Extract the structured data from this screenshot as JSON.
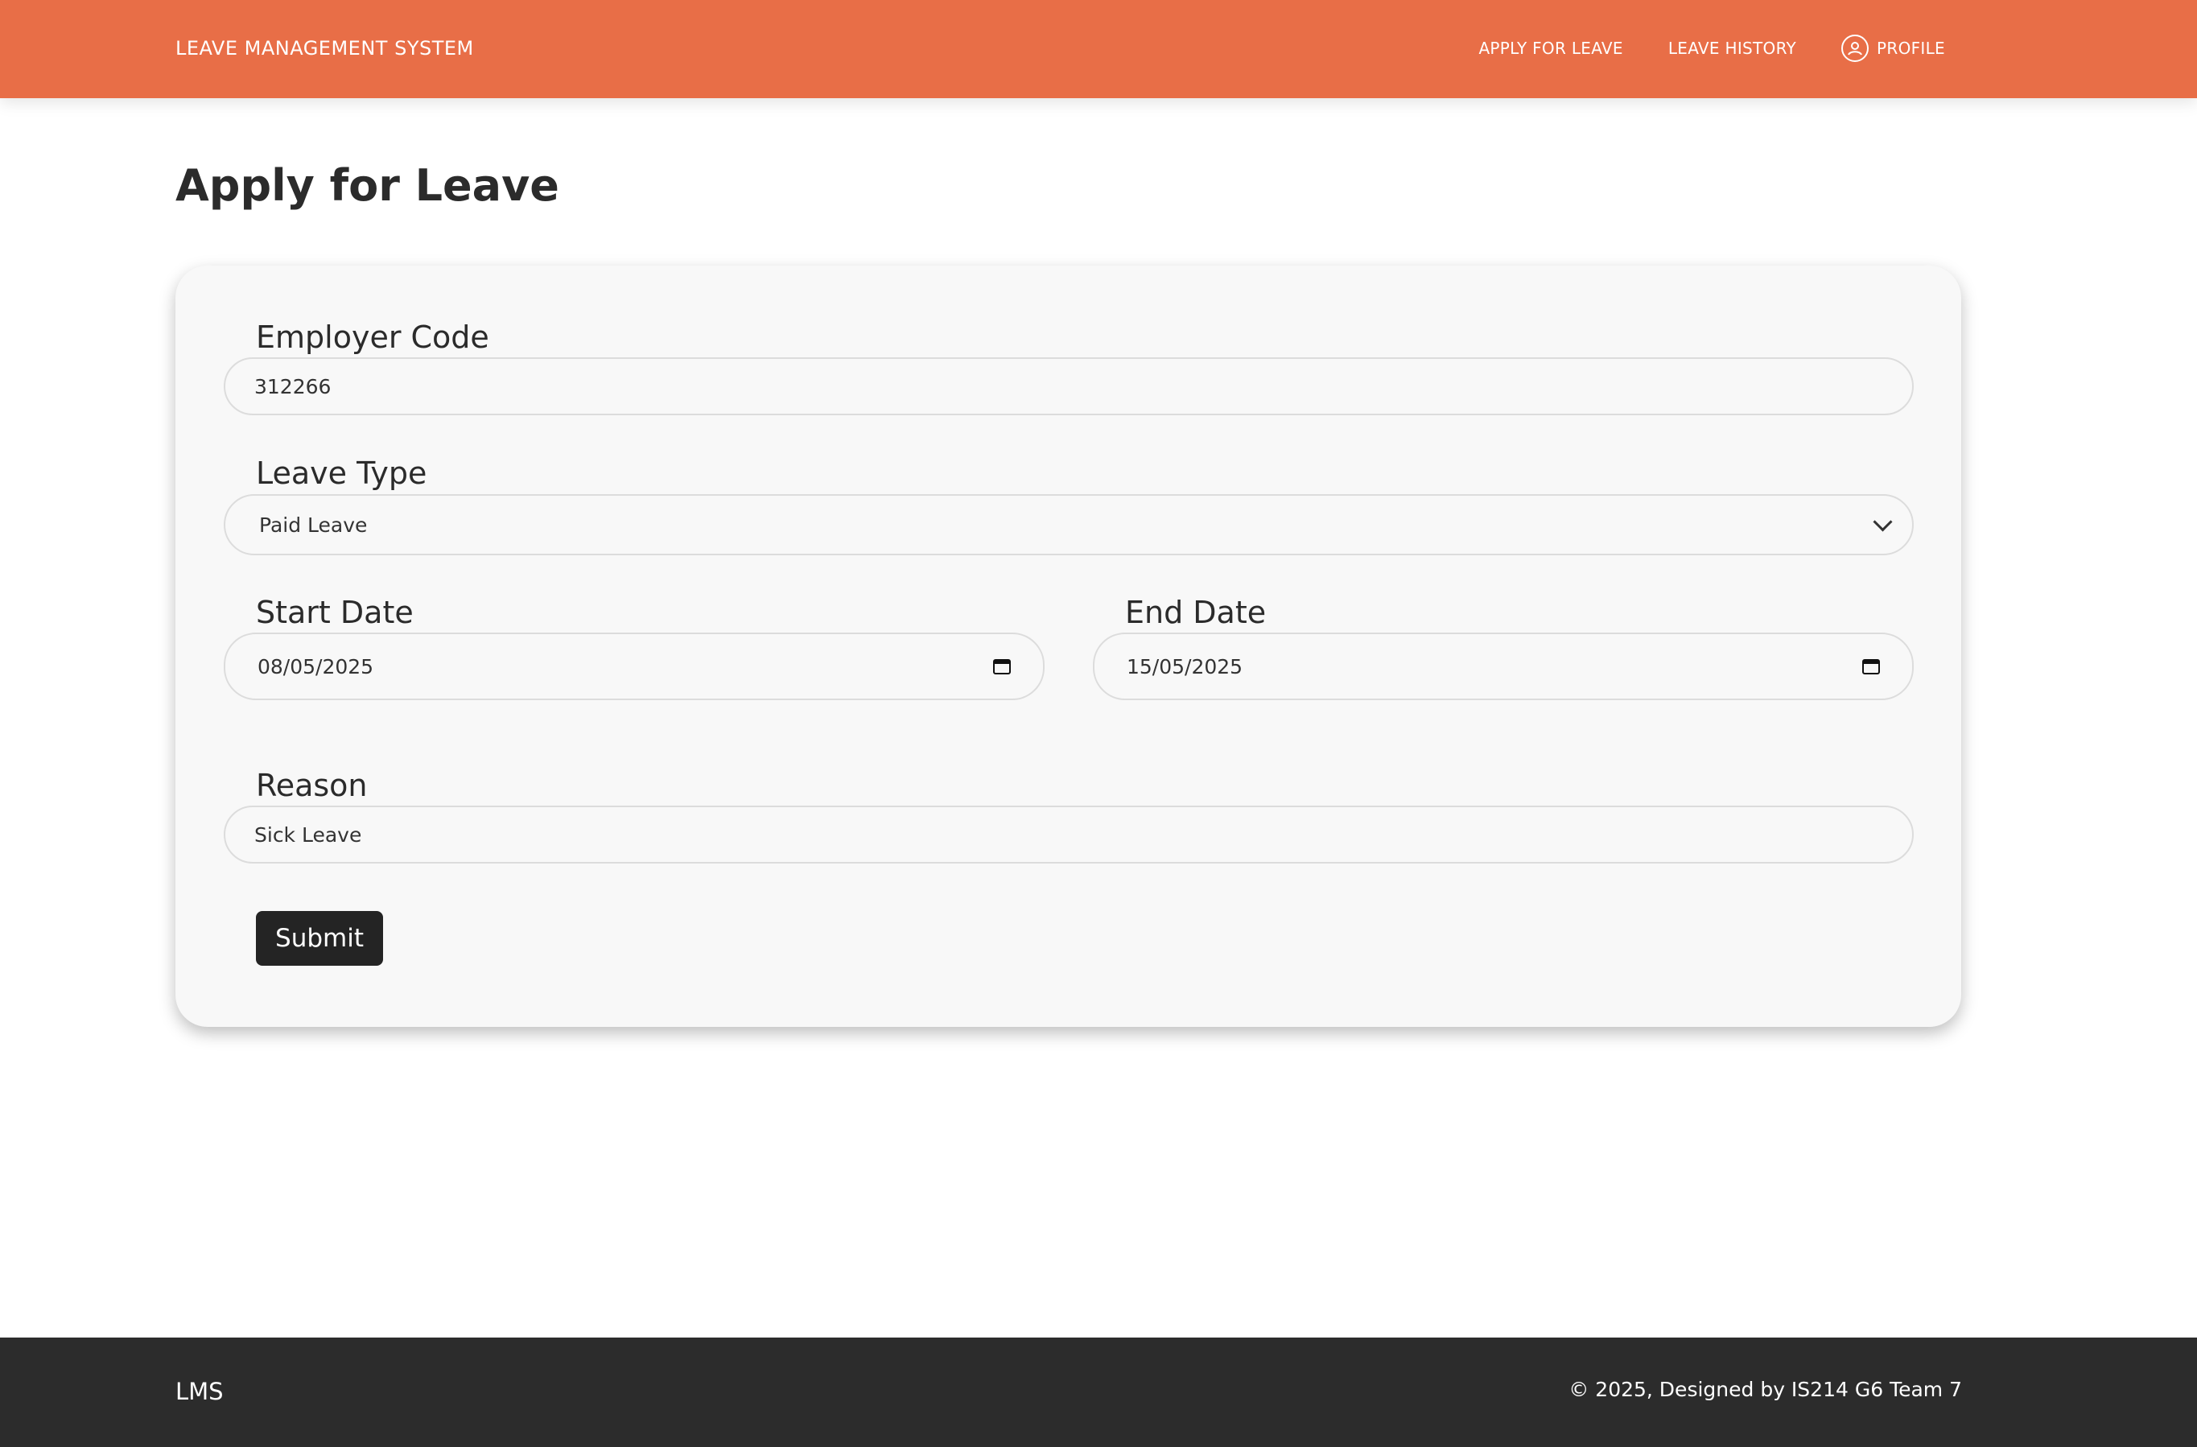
{
  "header": {
    "brand": "LEAVE MANAGEMENT SYSTEM",
    "nav": {
      "apply": "APPLY FOR LEAVE",
      "history": "LEAVE HISTORY",
      "profile": "PROFILE"
    },
    "accent_color": "#e86e47"
  },
  "page": {
    "title": "Apply for Leave"
  },
  "form": {
    "employer_code": {
      "label": "Employer Code",
      "value": "312266"
    },
    "leave_type": {
      "label": "Leave Type",
      "value": "Paid Leave"
    },
    "start_date": {
      "label": "Start Date",
      "value": "08/05/2025"
    },
    "end_date": {
      "label": "End Date",
      "value": "15/05/2025"
    },
    "reason": {
      "label": "Reason",
      "value": "Sick Leave"
    },
    "submit_label": "Submit"
  },
  "footer": {
    "brand": "LMS",
    "copyright": "© 2025, Designed by IS214 G6 Team 7",
    "background_color": "#2c2c2c"
  }
}
